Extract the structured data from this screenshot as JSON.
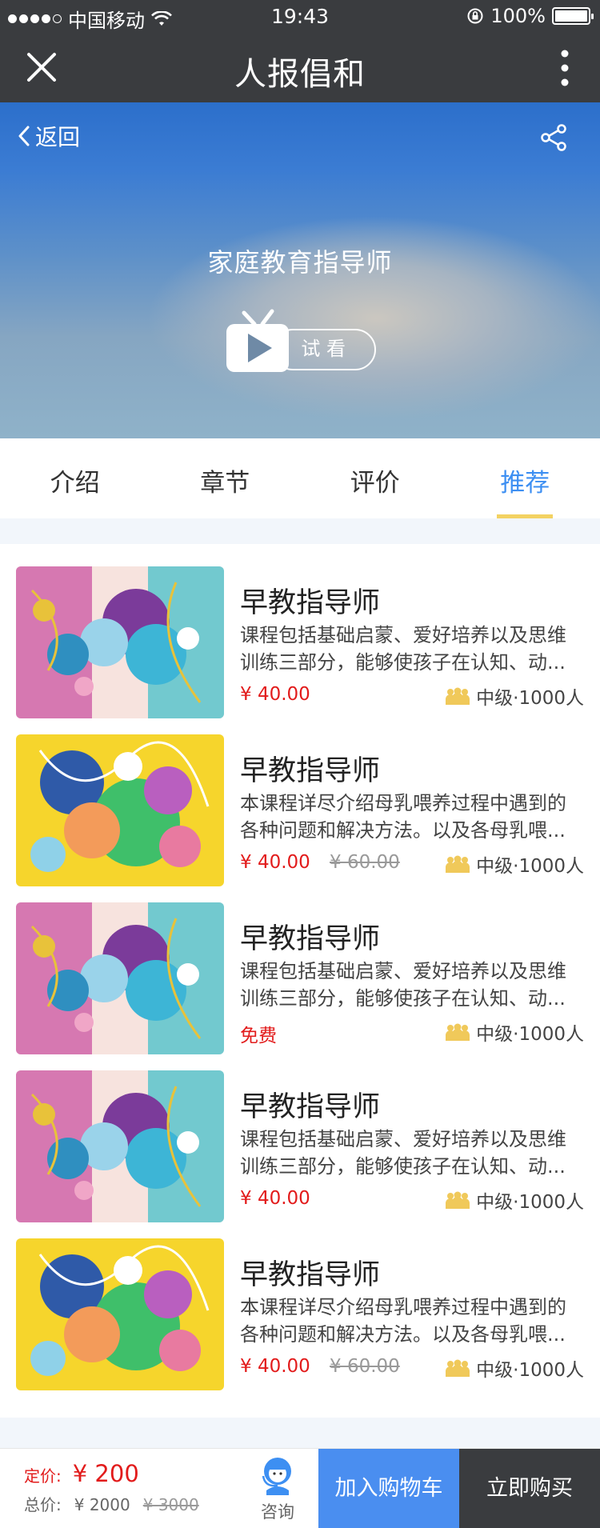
{
  "status_bar": {
    "carrier": "中国移动",
    "time": "19:43",
    "battery": "100%"
  },
  "navbar": {
    "title": "人报倡和"
  },
  "hero": {
    "back_label": "返回",
    "course_title": "家庭教育指导师",
    "trial_label": "试 看"
  },
  "tabs": [
    {
      "label": "介绍",
      "active": false
    },
    {
      "label": "章节",
      "active": false
    },
    {
      "label": "评价",
      "active": false
    },
    {
      "label": "推荐",
      "active": true
    }
  ],
  "items": [
    {
      "name": "早教指导师",
      "desc": "课程包括基础启蒙、爱好培养以及思维训练三部分，能够使孩子在认知、动...",
      "price": "¥ 40.00",
      "old_price": "",
      "meta": "中级·1000人",
      "thumb_style": "pink"
    },
    {
      "name": "早教指导师",
      "desc": "本课程详尽介绍母乳喂养过程中遇到的各种问题和解决方法。以及各母乳喂...",
      "price": "¥ 40.00",
      "old_price": "¥ 60.00",
      "meta": "中级·1000人",
      "thumb_style": "yellow"
    },
    {
      "name": "早教指导师",
      "desc": "课程包括基础启蒙、爱好培养以及思维训练三部分，能够使孩子在认知、动...",
      "price": "免费",
      "old_price": "",
      "meta": "中级·1000人",
      "thumb_style": "pink"
    },
    {
      "name": "早教指导师",
      "desc": "课程包括基础启蒙、爱好培养以及思维训练三部分，能够使孩子在认知、动...",
      "price": "¥ 40.00",
      "old_price": "",
      "meta": "中级·1000人",
      "thumb_style": "pink"
    },
    {
      "name": "早教指导师",
      "desc": "本课程详尽介绍母乳喂养过程中遇到的各种问题和解决方法。以及各母乳喂...",
      "price": "¥ 40.00",
      "old_price": "¥ 60.00",
      "meta": "中级·1000人",
      "thumb_style": "yellow"
    }
  ],
  "bottom_bar": {
    "list_price_label": "定价:",
    "list_price": "¥ 200",
    "total_label": "总价:",
    "total": "¥ 2000",
    "total_old": "¥ 3000",
    "consult_label": "咨询",
    "add_to_cart": "加入购物车",
    "buy_now": "立即购买"
  },
  "colors": {
    "accent_blue": "#3d8ff2",
    "price_red": "#e21b1b",
    "tab_underline": "#f3d262",
    "dark_bar": "#3a3c3f"
  }
}
